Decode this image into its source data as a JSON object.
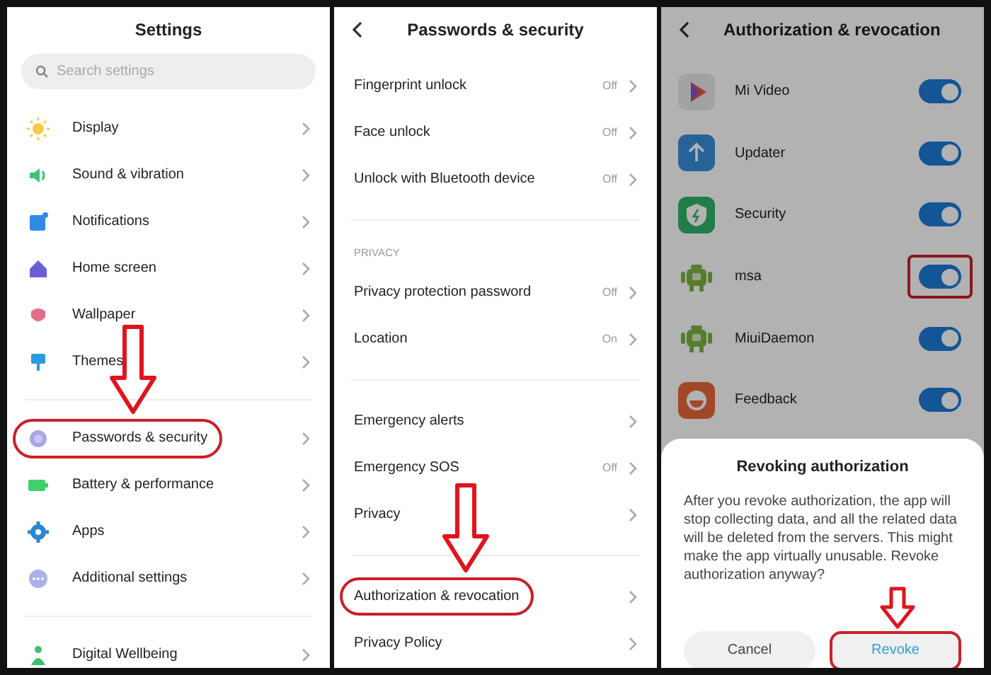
{
  "settings": {
    "title": "Settings",
    "search": {
      "placeholder": "Search settings"
    },
    "sections": [
      {
        "items": [
          {
            "label": "Display",
            "highlighted": false,
            "arrow": false
          },
          {
            "label": "Sound & vibration",
            "highlighted": false,
            "arrow": false
          },
          {
            "label": "Notifications",
            "highlighted": false,
            "arrow": false
          },
          {
            "label": "Home screen",
            "highlighted": false,
            "arrow": false
          },
          {
            "label": "Wallpaper",
            "highlighted": false,
            "arrow": false
          },
          {
            "label": "Themes",
            "highlighted": false,
            "arrow": false
          }
        ]
      },
      {
        "items": [
          {
            "label": "Passwords & security",
            "highlighted": true,
            "arrow": true
          },
          {
            "label": "Battery & performance",
            "highlighted": false,
            "arrow": false
          },
          {
            "label": "Apps",
            "highlighted": false,
            "arrow": false
          },
          {
            "label": "Additional settings",
            "highlighted": false,
            "arrow": false
          }
        ]
      },
      {
        "items": [
          {
            "label": "Digital Wellbeing",
            "highlighted": false,
            "arrow": false
          }
        ]
      }
    ]
  },
  "passwords_security": {
    "title": "Passwords & security",
    "sections": [
      {
        "items": [
          {
            "label": "Fingerprint unlock",
            "value": "Off",
            "highlighted": false,
            "arrow": false
          },
          {
            "label": "Face unlock",
            "value": "Off",
            "highlighted": false,
            "arrow": false
          },
          {
            "label": "Unlock with Bluetooth device",
            "value": "Off",
            "highlighted": false,
            "arrow": false
          }
        ]
      },
      {
        "heading": "PRIVACY",
        "items": [
          {
            "label": "Privacy protection password",
            "value": "Off",
            "highlighted": false,
            "arrow": false
          },
          {
            "label": "Location",
            "value": "On",
            "highlighted": false,
            "arrow": false
          }
        ]
      },
      {
        "items": [
          {
            "label": "Emergency alerts",
            "highlighted": false,
            "arrow": false
          },
          {
            "label": "Emergency SOS",
            "value": "Off",
            "highlighted": false,
            "arrow": false
          },
          {
            "label": "Privacy",
            "highlighted": false,
            "arrow": false
          }
        ]
      },
      {
        "items": [
          {
            "label": "Authorization & revocation",
            "highlighted": true,
            "arrow": true
          },
          {
            "label": "Privacy Policy",
            "highlighted": false,
            "arrow": false
          }
        ]
      }
    ]
  },
  "authorization": {
    "title": "Authorization & revocation",
    "apps": [
      {
        "name": "Mi Video",
        "on": true,
        "highlighted": false
      },
      {
        "name": "Updater",
        "on": true,
        "highlighted": false
      },
      {
        "name": "Security",
        "on": true,
        "highlighted": false
      },
      {
        "name": "msa",
        "on": true,
        "highlighted": true
      },
      {
        "name": "MiuiDaemon",
        "on": true,
        "highlighted": false
      },
      {
        "name": "Feedback",
        "on": true,
        "highlighted": false
      }
    ],
    "dialog": {
      "title": "Revoking authorization",
      "message": "After you revoke authorization, the app will stop collecting data, and all the related data will be deleted from the servers. This might make the app virtually unusable. Revoke authorization anyway?",
      "buttons": [
        {
          "label": "Cancel",
          "primary": false,
          "highlighted": false,
          "arrow": false
        },
        {
          "label": "Revoke",
          "primary": true,
          "highlighted": true,
          "arrow": true
        }
      ]
    }
  }
}
